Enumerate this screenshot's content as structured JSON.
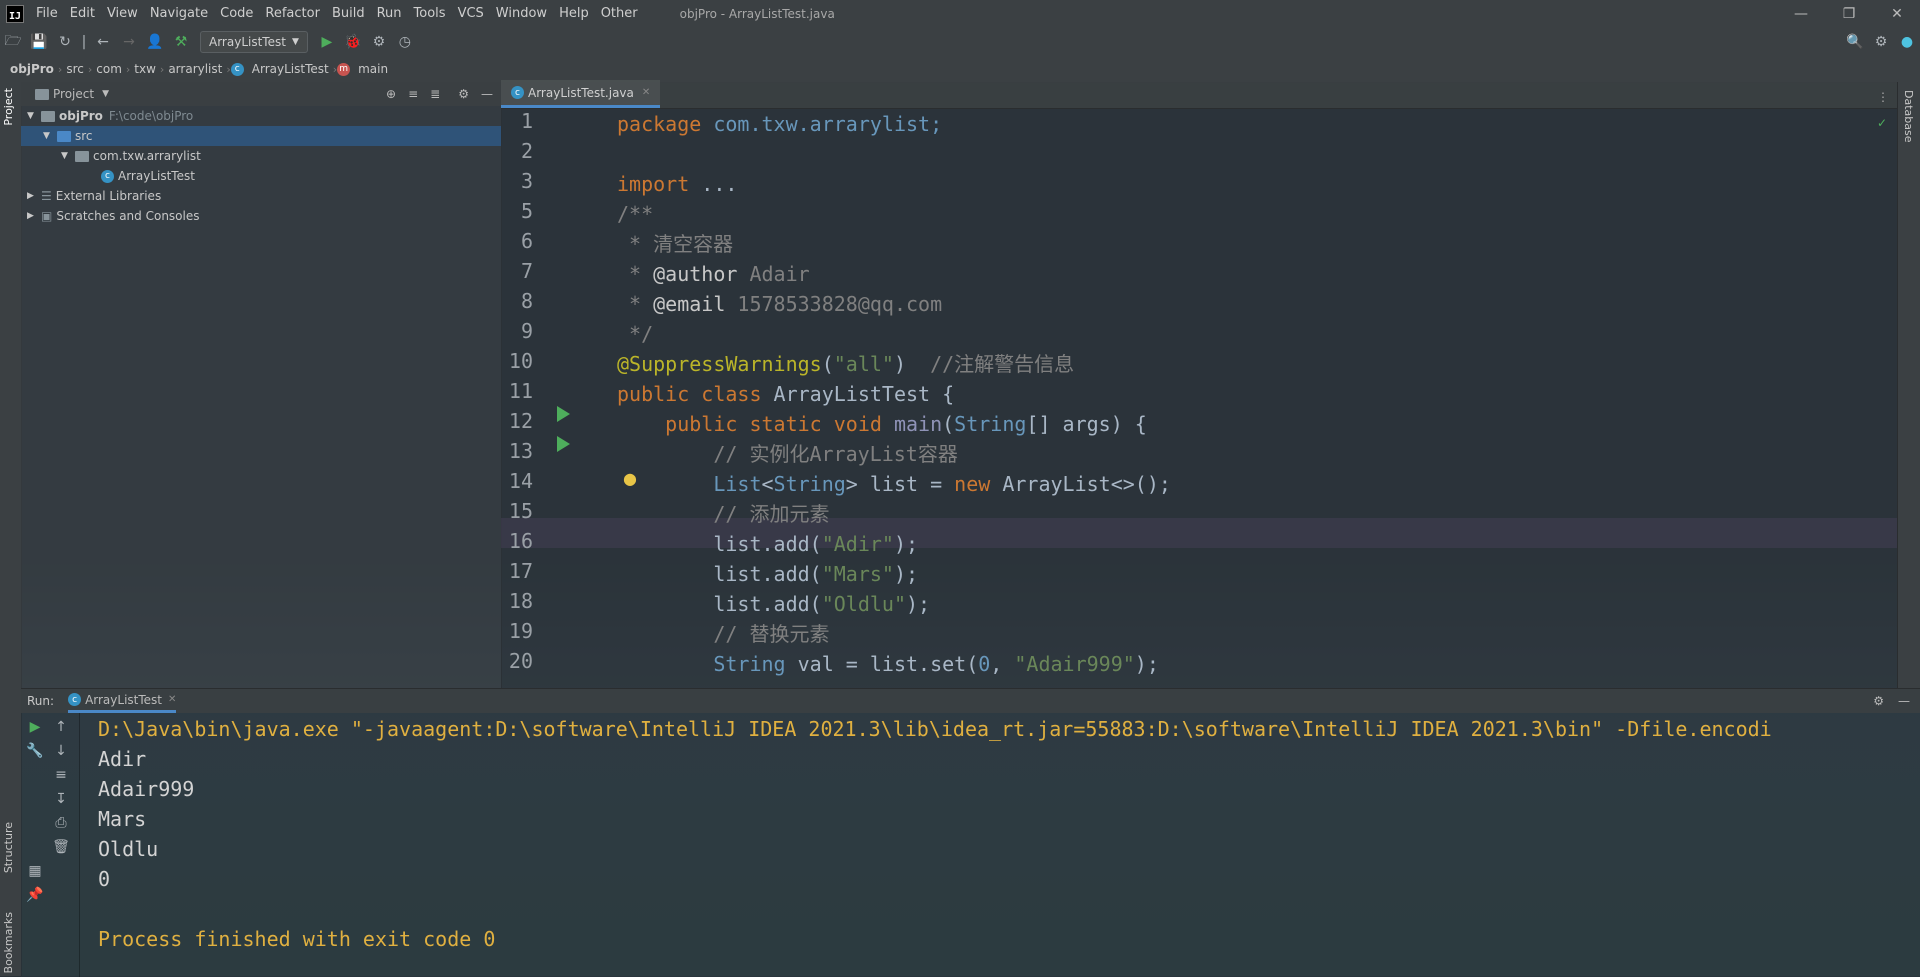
{
  "app": {
    "window_title": "objPro - ArrayListTest.java",
    "logo_text": "IJ"
  },
  "menu": [
    "File",
    "Edit",
    "View",
    "Navigate",
    "Code",
    "Refactor",
    "Build",
    "Run",
    "Tools",
    "VCS",
    "Window",
    "Help",
    "Other"
  ],
  "toolbar": {
    "run_config": "ArrayListTest"
  },
  "breadcrumb": [
    "objPro",
    "src",
    "com",
    "txw",
    "arrarylist",
    "ArrayListTest",
    "main"
  ],
  "left_stripe": {
    "project": "Project",
    "structure": "Structure",
    "bookmarks": "Bookmarks"
  },
  "right_stripe": {
    "database": "Database"
  },
  "project_panel": {
    "title": "Project",
    "tree": [
      {
        "label": "objPro",
        "path": "F:\\code\\objPro"
      },
      {
        "label": "src"
      },
      {
        "label": "com.txw.arrarylist"
      },
      {
        "label": "ArrayListTest"
      },
      {
        "label": "External Libraries"
      },
      {
        "label": "Scratches and Consoles"
      }
    ]
  },
  "editor": {
    "tab": "ArrayListTest.java",
    "line_numbers": [
      "1",
      "2",
      "3",
      "5",
      "6",
      "7",
      "8",
      "9",
      "10",
      "11",
      "12",
      "13",
      "14",
      "15",
      "16",
      "17",
      "18",
      "19",
      "20"
    ],
    "code": {
      "l1_kw": "package",
      "l1_rest": " com.txw.arrarylist;",
      "l3_kw": "import",
      "l3_rest": " ...",
      "l5": "/**",
      "l6": " * 清空容器",
      "l7_a": " * ",
      "l7_tag": "@author",
      "l7_val": " Adair",
      "l8_a": " * ",
      "l8_tag": "@email",
      "l8_val": " 1578533828@qq.com",
      "l9": " */",
      "l10_an": "@SuppressWarnings",
      "l10_p1": "(",
      "l10_str": "\"all\"",
      "l10_p2": ")  ",
      "l10_cm": "//注解警告信息",
      "l11_kw": "public class",
      "l11_rest": " ArrayListTest {",
      "l12_kw": "    public static void",
      "l12_fn": " main",
      "l12_p": "(",
      "l12_ty": "String",
      "l12_rest": "[] args) {",
      "l13": "        // 实例化ArrayList容器",
      "l14_ty": "        List",
      "l14_a": "<",
      "l14_ty2": "String",
      "l14_b": "> list = ",
      "l14_kw": "new",
      "l14_rest": " ArrayList<>();",
      "l15": "        // 添加元素",
      "l16_a": "        list.add(",
      "l16_s": "\"Adir\"",
      "l16_b": ");",
      "l17_a": "        list.add(",
      "l17_s": "\"Mars\"",
      "l17_b": ");",
      "l18_a": "        list.add(",
      "l18_s": "\"Oldlu\"",
      "l18_b": ");",
      "l19": "        // 替换元素",
      "l20_ty": "        String",
      "l20_a": " val = list.set(",
      "l20_n": "0",
      "l20_b": ", ",
      "l20_s": "\"Adair999\"",
      "l20_c": ");"
    }
  },
  "run_panel": {
    "label": "Run:",
    "tab": "ArrayListTest",
    "output": [
      "D:\\Java\\bin\\java.exe \"-javaagent:D:\\software\\IntelliJ IDEA 2021.3\\lib\\idea_rt.jar=55883:D:\\software\\IntelliJ IDEA 2021.3\\bin\" -Dfile.encodi",
      "Adir",
      "Adair999",
      "Mars",
      "Oldlu",
      "0",
      "",
      "Process finished with exit code 0"
    ]
  },
  "colors": {
    "accent": "#4a88c7",
    "run_green": "#4eae5c",
    "console_system": "#e0b040"
  }
}
